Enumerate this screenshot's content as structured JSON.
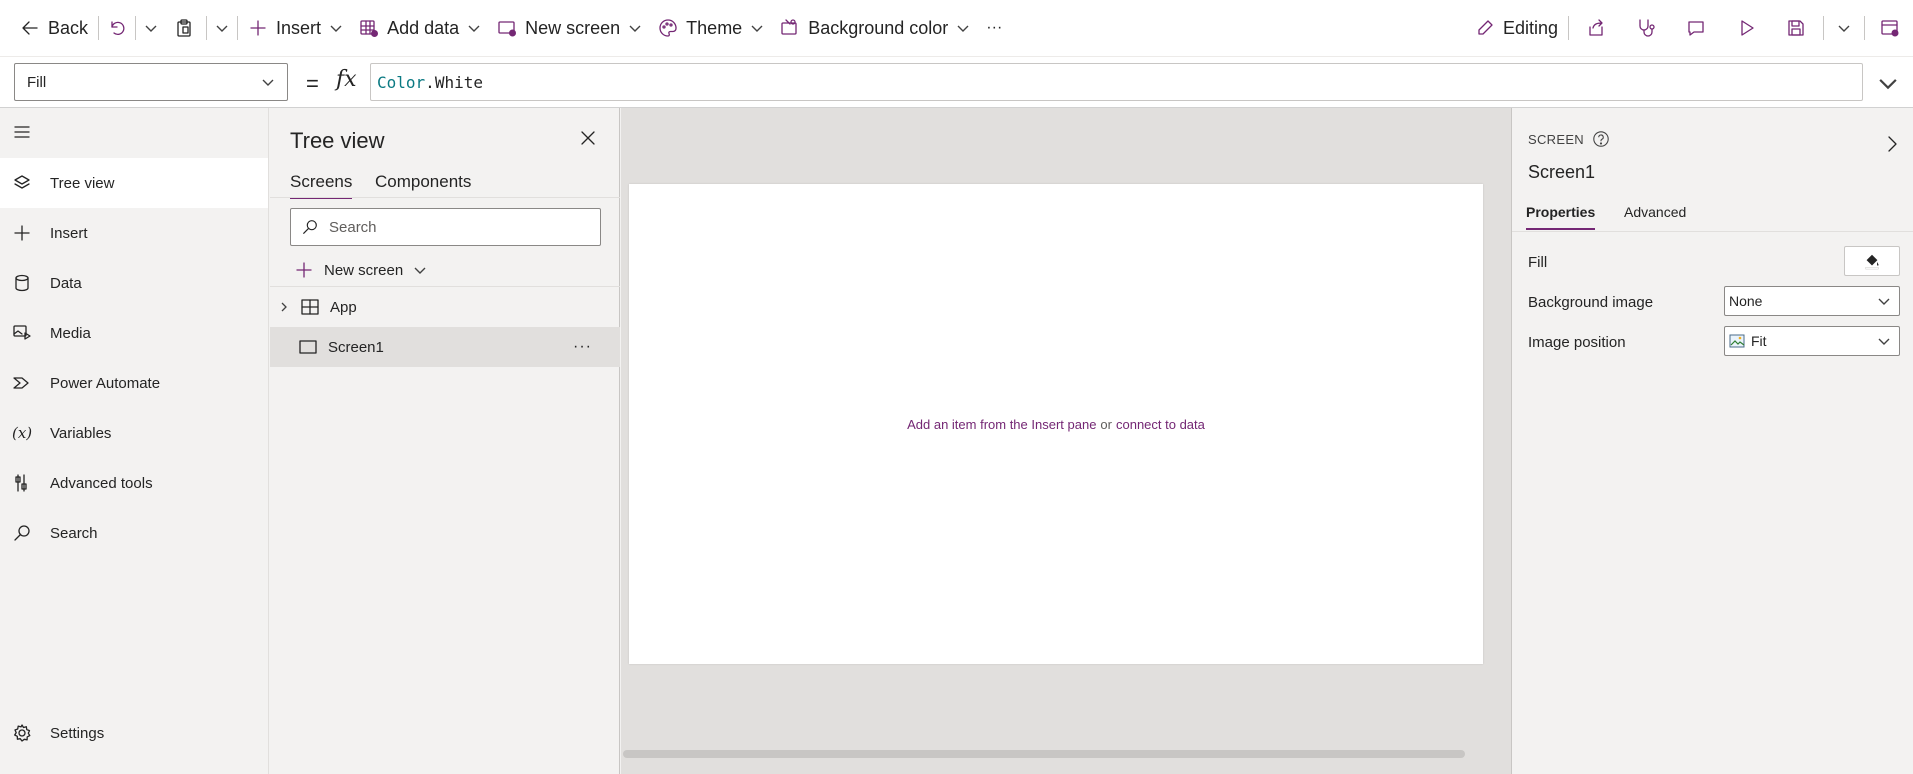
{
  "toolbar": {
    "back": "Back",
    "insert": "Insert",
    "add_data": "Add data",
    "new_screen": "New screen",
    "theme": "Theme",
    "background_color": "Background color",
    "more": "···",
    "editing": "Editing"
  },
  "formula_bar": {
    "property": "Fill",
    "equals": "=",
    "fx": "fx",
    "formula_object": "Color",
    "formula_dot": ".",
    "formula_member": "White"
  },
  "left_nav": {
    "items": [
      {
        "label": "Tree view",
        "icon": "layers-icon",
        "active": true
      },
      {
        "label": "Insert",
        "icon": "plus-icon"
      },
      {
        "label": "Data",
        "icon": "database-icon"
      },
      {
        "label": "Media",
        "icon": "media-icon"
      },
      {
        "label": "Power Automate",
        "icon": "power-automate-icon"
      },
      {
        "label": "Variables",
        "icon": "variables-icon"
      },
      {
        "label": "Advanced tools",
        "icon": "tools-icon"
      },
      {
        "label": "Search",
        "icon": "search-icon"
      }
    ],
    "settings": "Settings"
  },
  "tree_view": {
    "title": "Tree view",
    "tabs": [
      "Screens",
      "Components"
    ],
    "active_tab": "Screens",
    "search_placeholder": "Search",
    "new_screen": "New screen",
    "nodes": [
      {
        "label": "App",
        "type": "app"
      },
      {
        "label": "Screen1",
        "type": "screen",
        "selected": true
      }
    ],
    "node_more": "···"
  },
  "canvas": {
    "hint_pre": "Add an item from the Insert pane",
    "hint_mid": "or",
    "hint_link": "connect to data"
  },
  "properties_panel": {
    "type_label": "SCREEN",
    "screen_name": "Screen1",
    "tabs": [
      "Properties",
      "Advanced"
    ],
    "active_tab": "Properties",
    "fill_label": "Fill",
    "background_image_label": "Background image",
    "background_image_value": "None",
    "image_position_label": "Image position",
    "image_position_value": "Fit"
  },
  "colors": {
    "accent": "#742774",
    "formula_token": "#0b7a83",
    "panel_bg": "#f3f2f1",
    "canvas_bg": "#e1dfdd"
  }
}
